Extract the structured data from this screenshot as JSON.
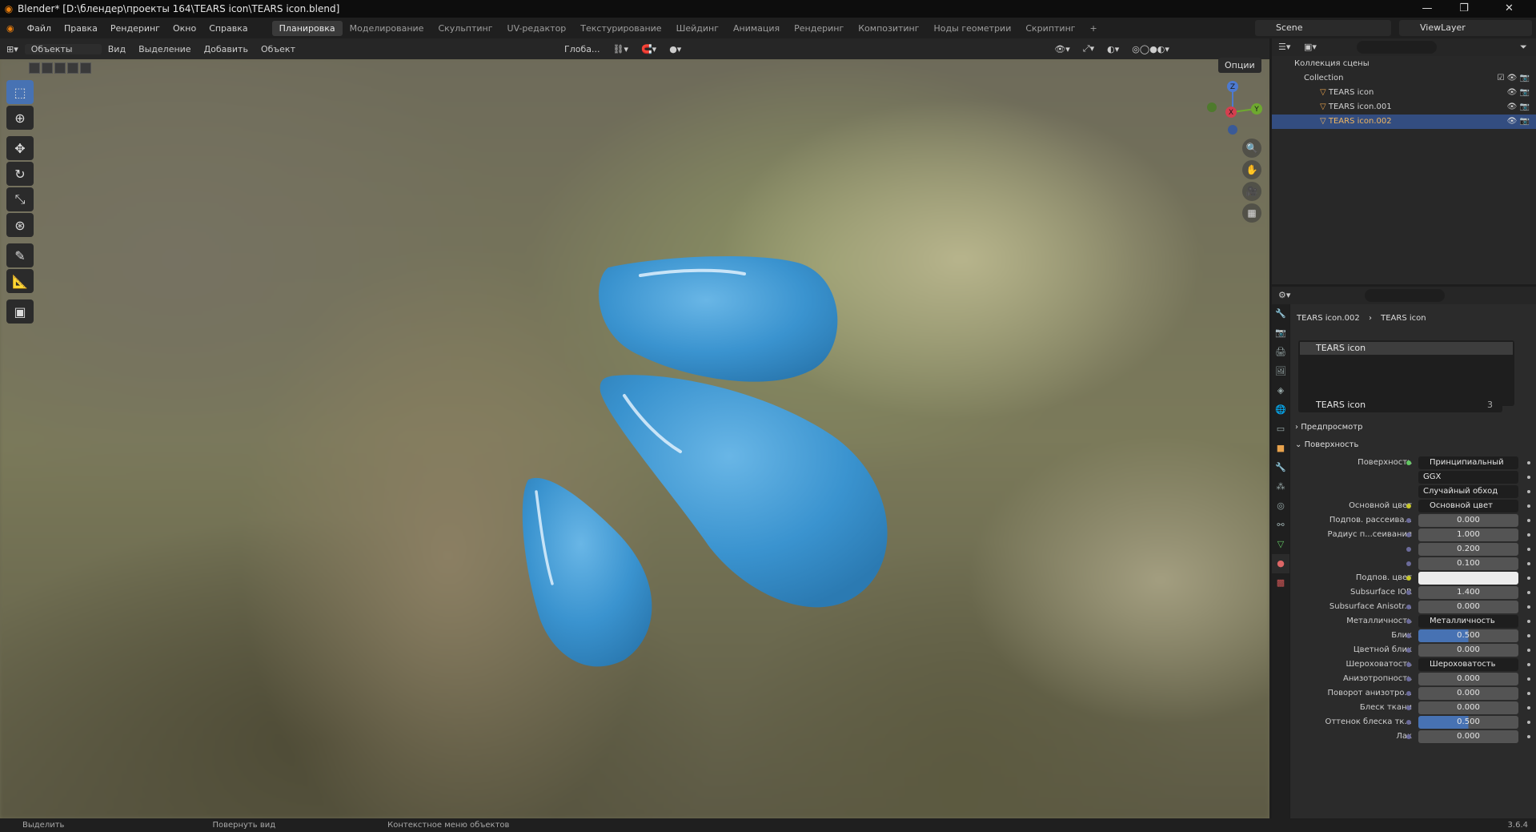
{
  "window": {
    "title": "Blender* [D:\\блендер\\проекты 164\\TEARS icon\\TEARS icon.blend]"
  },
  "menu": [
    "Файл",
    "Правка",
    "Рендеринг",
    "Окно",
    "Справка"
  ],
  "workspaces": [
    "Планировка",
    "Моделирование",
    "Скульптинг",
    "UV-редактор",
    "Текстурирование",
    "Шейдинг",
    "Анимация",
    "Рендеринг",
    "Композитинг",
    "Ноды геометрии",
    "Скриптинг"
  ],
  "scene": "Scene",
  "viewlayer": "ViewLayer",
  "viewport": {
    "mode": "Объекты",
    "menu": [
      "Вид",
      "Выделение",
      "Добавить",
      "Объект"
    ],
    "orientation": "Глоба...",
    "options": "Опции"
  },
  "gizmo": {
    "x": "X",
    "y": "Y",
    "z": "Z"
  },
  "outliner": {
    "root": "Коллекция сцены",
    "collection": "Collection",
    "items": [
      "TEARS icon",
      "TEARS icon.001",
      "TEARS icon.002"
    ]
  },
  "props": {
    "breadcrumb_obj": "TEARS icon.002",
    "breadcrumb_mat": "TEARS icon",
    "slot": "TEARS icon",
    "material": "TEARS icon",
    "users": "3",
    "preview": "Предпросмотр",
    "surface_section": "Поверхность",
    "rows": [
      {
        "label": "Поверхность",
        "value": "Принципиальный BSDF",
        "kind": "link",
        "dot": "g"
      },
      {
        "label": "",
        "value": "GGX",
        "kind": "dd2"
      },
      {
        "label": "",
        "value": "Случайный обход",
        "kind": "dd2"
      },
      {
        "label": "Основной цвет",
        "value": "Основной цвет",
        "kind": "link",
        "dot": "y"
      },
      {
        "label": "Подпов. рассеива...",
        "value": "0.000",
        "kind": "num"
      },
      {
        "label": "Радиус п...сеивания",
        "value": "1.000",
        "kind": "num"
      },
      {
        "label": "",
        "value": "0.200",
        "kind": "num"
      },
      {
        "label": "",
        "value": "0.100",
        "kind": "num"
      },
      {
        "label": "Подпов. цвет",
        "value": "",
        "kind": "white",
        "dot": "y"
      },
      {
        "label": "Subsurface IOR",
        "value": "1.400",
        "kind": "num"
      },
      {
        "label": "Subsurface Anisotr...",
        "value": "0.000",
        "kind": "num"
      },
      {
        "label": "Металличность",
        "value": "Металличность",
        "kind": "link"
      },
      {
        "label": "Блик",
        "value": "0.500",
        "kind": "blue"
      },
      {
        "label": "Цветной блик",
        "value": "0.000",
        "kind": "num"
      },
      {
        "label": "Шероховатость",
        "value": "Шероховатость",
        "kind": "link"
      },
      {
        "label": "Анизотропность",
        "value": "0.000",
        "kind": "num"
      },
      {
        "label": "Поворот анизотро...",
        "value": "0.000",
        "kind": "num"
      },
      {
        "label": "Блеск ткани",
        "value": "0.000",
        "kind": "num"
      },
      {
        "label": "Оттенок блеска тк...",
        "value": "0.500",
        "kind": "blue"
      },
      {
        "label": "Лак",
        "value": "0.000",
        "kind": "num"
      }
    ]
  },
  "status": {
    "select": "Выделить",
    "rotate": "Повернуть вид",
    "context": "Контекстное меню объектов",
    "version": "3.6.4"
  }
}
